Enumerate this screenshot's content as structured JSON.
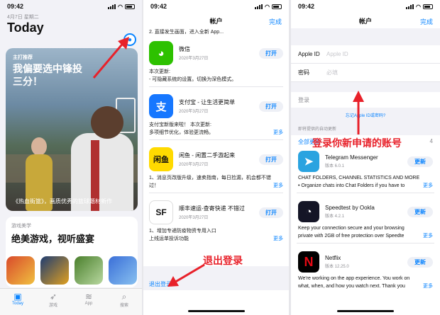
{
  "status": {
    "time": "09:42",
    "wifi_icon": "wifi-icon",
    "battery_icon": "battery-icon"
  },
  "panel1": {
    "date": "4月7日 星期二",
    "title": "Today",
    "avatar_icon": "person-icon",
    "feature": {
      "tag": "主打推荐",
      "title": "我偏要选中锋投三分！",
      "caption": "《热血街篮》，画质优秀的篮球题材新作"
    },
    "card2": {
      "tag": "游戏美学",
      "title": "绝美游戏，视听盛宴"
    },
    "tabs": [
      {
        "label": "Today",
        "icon": "today-icon",
        "active": true
      },
      {
        "label": "游戏",
        "icon": "rocket-icon",
        "active": false
      },
      {
        "label": "App",
        "icon": "layers-icon",
        "active": false
      },
      {
        "label": "搜索",
        "icon": "search-icon",
        "active": false
      }
    ]
  },
  "panel2": {
    "nav_title": "帐户",
    "done": "完成",
    "top_clip": "2. 直接发生画面，进入全新 App...",
    "apps": [
      {
        "name": "微信",
        "date": "2020年3月27日",
        "button": "打开",
        "icon": "wechat-icon",
        "color": "#2dc100",
        "notes": [
          "本次更新:",
          "- 可隐藏系统的设置。切换为深色模式。"
        ],
        "more": ""
      },
      {
        "name": "支付宝 - 让生活更简单",
        "date": "2020年3月27日",
        "button": "打开",
        "icon": "alipay-icon",
        "color": "#1677ff",
        "notes": [
          "支付宝新版来啦！ 本次更新:",
          "多项细节优化，体验更流畅。"
        ],
        "more": "更多"
      },
      {
        "name": "闲鱼 - 闲置二手游起来",
        "date": "2020年3月27日",
        "button": "打开",
        "icon": "xianyu-icon",
        "color": "#ffda00",
        "notes": [
          "1、消息页改版升级，速卖指南，每日捡漏，机会都不错",
          "过！"
        ],
        "more": "更多"
      },
      {
        "name": "顺丰速运-查寄快递 不错过",
        "date": "2020年3月27日",
        "button": "打开",
        "icon": "sf-icon",
        "color": "#ffffff",
        "notes": [
          "1、增加专递防疫物资专用入口",
          "上线运单投诉功能"
        ],
        "more": "更多"
      }
    ],
    "logout": "退出登录"
  },
  "panel3": {
    "nav_title": "帐户",
    "done": "完成",
    "apple_id_label": "Apple ID",
    "apple_id_placeholder": "Apple ID",
    "password_label": "密码",
    "password_placeholder": "必填",
    "login": "登录",
    "forgot": "忘记Apple ID或密码?",
    "auto_update": "即将提供的自动更新",
    "update_all": "全部更新",
    "update_count": "4",
    "apps": [
      {
        "name": "Telegram Messenger",
        "version": "版本 6.0.1",
        "button": "更新",
        "icon": "telegram-icon",
        "color": "#2aa3e0",
        "notes": [
          "CHAT FOLDERS, CHANNEL STATISTICS AND MORE",
          "• Organize chats into Chat Folders if you have to"
        ],
        "more": "更多"
      },
      {
        "name": "Speedtest by Ookla",
        "version": "版本 4.2.1",
        "button": "更新",
        "icon": "speedtest-icon",
        "color": "#141526",
        "notes": [
          "Keep your connection secure and your browsing",
          "private with 2GB of free protection over Speedte"
        ],
        "more": "更多"
      },
      {
        "name": "Netflix",
        "version": "版本 12.25.0",
        "button": "更新",
        "icon": "netflix-icon",
        "color": "#000000",
        "notes": [
          "We're working on the app experience. You work on",
          "what, when, and how you watch next. Thank you"
        ],
        "more": "更多"
      }
    ]
  },
  "annotations": {
    "logout_hint": "退出登录",
    "register_hint": "登录你新申请的账号",
    "color": "#e8212a"
  }
}
